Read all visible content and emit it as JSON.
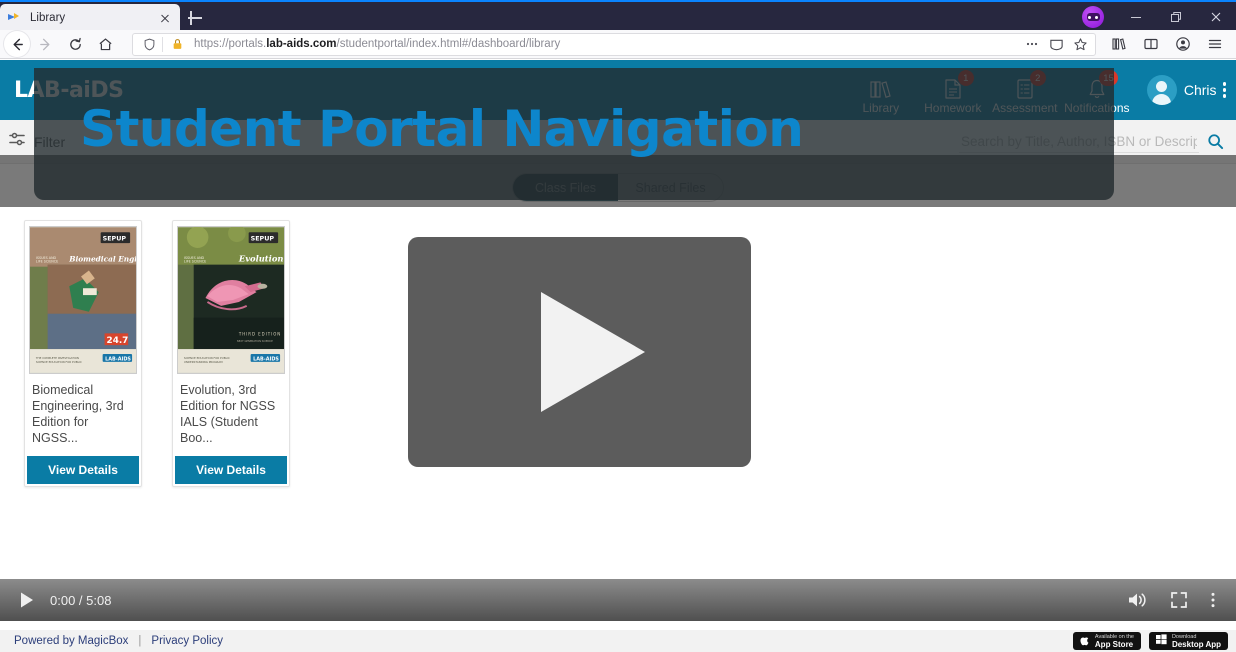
{
  "browser": {
    "tab": {
      "title": "Library",
      "favicon_icon": "site-favicon",
      "close_icon": "close-icon"
    },
    "new_tab_label": "+",
    "nav": {
      "back_icon": "back-arrow-icon",
      "forward_icon": "forward-arrow-icon",
      "reload_icon": "reload-icon",
      "home_icon": "home-icon"
    },
    "url": {
      "scheme": "https://portals.",
      "domain": "lab-aids.com",
      "path": "/studentportal/index.html#/dashboard/library",
      "shield_icon": "tracking-protection-shield-icon",
      "lock_icon": "padlock-warning-icon",
      "more_icon": "page-actions-ellipsis-icon",
      "reader_icon": "reader-view-icon",
      "bookmark_icon": "bookmark-star-icon"
    },
    "toolbar": {
      "library_icon": "library-icon",
      "sidebar_icon": "sidebar-icon",
      "account_icon": "account-icon",
      "menu_icon": "hamburger-menu-icon"
    },
    "window": {
      "extension_icon": "incognito-mask-extension-icon",
      "minimize_icon": "minimize-icon",
      "restore_icon": "restore-icon",
      "close_icon": "window-close-icon"
    }
  },
  "app": {
    "logo_text": "LAB-aiDS",
    "header_nav": [
      {
        "label": "Library",
        "icon": "books-icon",
        "badge": ""
      },
      {
        "label": "Homework",
        "icon": "document-icon",
        "badge": "1"
      },
      {
        "label": "Assessment",
        "icon": "checklist-icon",
        "badge": "2"
      },
      {
        "label": "Notifications",
        "icon": "bell-icon",
        "badge": "15"
      }
    ],
    "user": {
      "name": "Chris",
      "avatar_icon": "user-avatar-icon",
      "menu_icon": "kebab-menu-icon"
    },
    "filter": {
      "label": "Filter",
      "icon": "filter-sliders-icon"
    },
    "search": {
      "placeholder": "Search by Title, Author, ISBN or Description",
      "value": "",
      "icon": "search-icon"
    },
    "tabs": [
      {
        "label": "Class Files",
        "active": true
      },
      {
        "label": "Shared Files",
        "active": false
      }
    ],
    "cards": [
      {
        "title": "Biomedical Engineering, 3rd Edition for NGSS...",
        "button": "View Details",
        "cover": {
          "publisher": "SEPUP",
          "series": "ISSUES AND LIFE SCIENCE",
          "subject": "Biomedical Engineering",
          "brand": "LAB-AIDS",
          "number": "24.7"
        }
      },
      {
        "title": "Evolution, 3rd Edition for NGSS IALS (Student Boo...",
        "button": "View Details",
        "cover": {
          "publisher": "SEPUP",
          "series": "ISSUES AND LIFE SCIENCE",
          "subject": "Evolution",
          "brand": "LAB-AIDS",
          "edition": "THIRD EDITION"
        }
      }
    ],
    "footer": {
      "powered_by": "Powered by MagicBox",
      "separator": "|",
      "privacy": "Privacy Policy",
      "app_store": {
        "line1": "Available on the",
        "line2": "App Store",
        "icon": "apple-icon"
      },
      "desktop_app": {
        "line1": "Download",
        "line2": "Desktop App",
        "icon": "windows-icon"
      }
    }
  },
  "overlay": {
    "title": "Student Portal Navigation"
  },
  "player": {
    "play_icon": "play-icon",
    "big_play_icon": "big-play-icon",
    "current_time": "0:00",
    "separator": "/",
    "duration": "5:08",
    "time_display": "0:00 / 5:08",
    "volume_icon": "volume-icon",
    "fullscreen_icon": "fullscreen-icon",
    "options_icon": "more-options-icon",
    "progress_percent": 0
  },
  "colors": {
    "brand_teal": "#0a7ca5",
    "overlay_title_blue": "#0d86cc",
    "badge_red": "#d9392b",
    "tab_active": "#2b5964",
    "player_grey": "#5c5c5c"
  }
}
